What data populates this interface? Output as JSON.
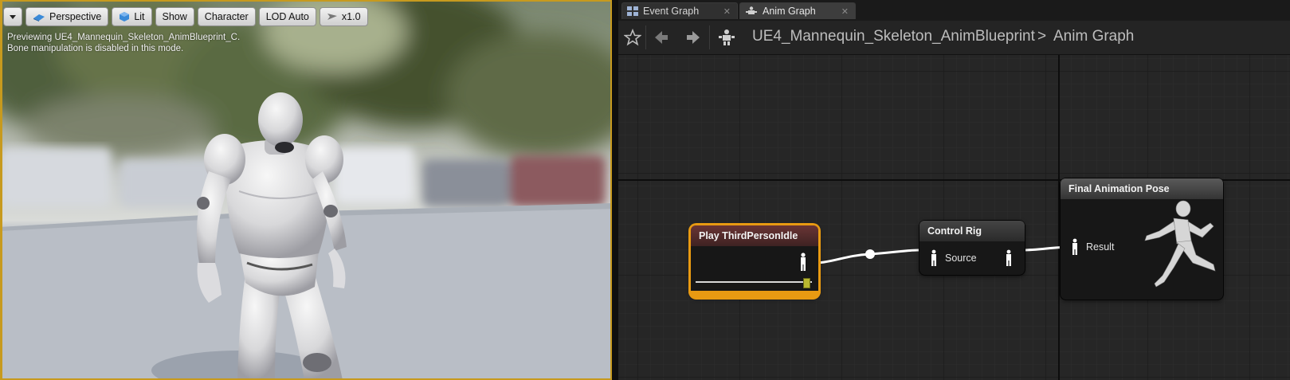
{
  "viewport": {
    "toolbar": {
      "perspective": "Perspective",
      "lit": "Lit",
      "show": "Show",
      "character": "Character",
      "lod": "LOD Auto",
      "speed": "x1.0"
    },
    "info_line1": "Previewing UE4_Mannequin_Skeleton_AnimBlueprint_C.",
    "info_line2": "Bone manipulation is disabled in this mode."
  },
  "tabs": [
    {
      "label": "Event Graph",
      "active": false
    },
    {
      "label": "Anim Graph",
      "active": true
    }
  ],
  "breadcrumb": {
    "blueprint": "UE4_Mannequin_Skeleton_AnimBlueprint",
    "separator": ">",
    "graph": "Anim Graph"
  },
  "nodes": {
    "play": {
      "title": "Play ThirdPersonIdle"
    },
    "control_rig": {
      "title": "Control Rig",
      "pin": "Source"
    },
    "final_pose": {
      "title": "Final Animation Pose",
      "pin": "Result"
    }
  },
  "colors": {
    "accent_orange": "#e89a12",
    "viewport_border": "#c79a1e",
    "wire": "#ffffff",
    "grid_bg": "#262626"
  }
}
